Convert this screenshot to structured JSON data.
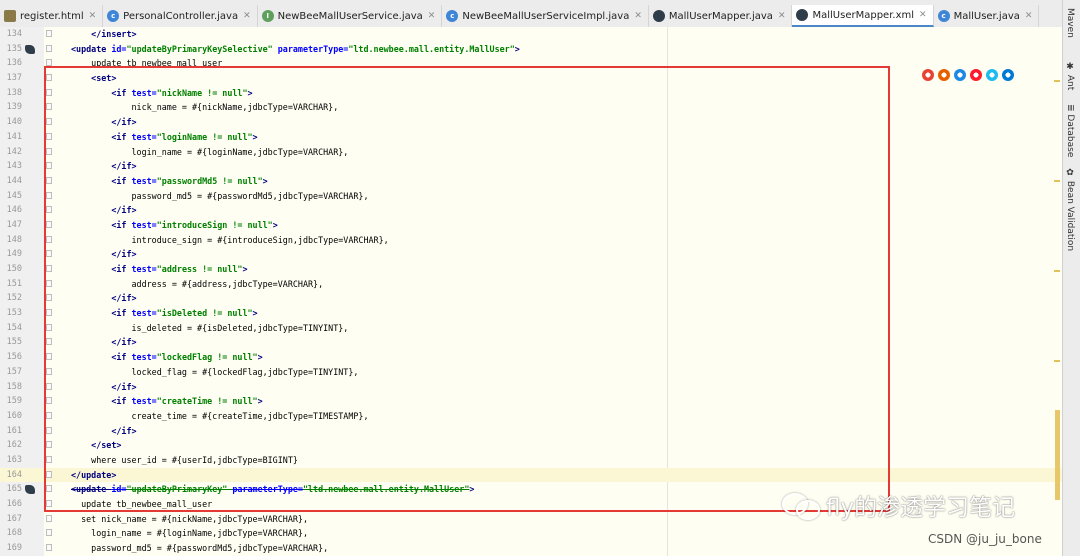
{
  "tabs": [
    {
      "label": "register.html",
      "icon": "html-file-icon",
      "color": "#8a7a4a",
      "glyph": "",
      "active": false
    },
    {
      "label": "PersonalController.java",
      "icon": "class-icon",
      "color": "#3f86d6",
      "glyph": "c",
      "active": false
    },
    {
      "label": "NewBeeMallUserService.java",
      "icon": "interface-icon",
      "color": "#5fa05f",
      "glyph": "I",
      "active": false
    },
    {
      "label": "NewBeeMallUserServiceImpl.java",
      "icon": "class-icon",
      "color": "#3f86d6",
      "glyph": "c",
      "active": false
    },
    {
      "label": "MallUserMapper.java",
      "icon": "mybatis-icon",
      "color": "#2f3d4a",
      "glyph": "",
      "active": false
    },
    {
      "label": "MallUserMapper.xml",
      "icon": "mybatis-icon",
      "color": "#2f3d4a",
      "glyph": "",
      "active": true
    },
    {
      "label": "MallUser.java",
      "icon": "class-icon",
      "color": "#3f86d6",
      "glyph": "c",
      "active": false
    }
  ],
  "lines": [
    {
      "num": "134",
      "parts": [
        {
          "t": "    ",
          "c": "body"
        },
        {
          "t": "</insert>",
          "c": "tag"
        }
      ]
    },
    {
      "num": "135",
      "icon": true,
      "hl": true,
      "parts": [
        {
          "t": "<update ",
          "c": "tag"
        },
        {
          "t": "id=",
          "c": "attr"
        },
        {
          "t": "\"updateByPrimaryKeySelective\" ",
          "c": "val"
        },
        {
          "t": "parameterType=",
          "c": "attr"
        },
        {
          "t": "\"ltd.newbee.mall.entity.MallUser\"",
          "c": "val"
        },
        {
          "t": ">",
          "c": "tag"
        }
      ]
    },
    {
      "num": "136",
      "parts": [
        {
          "t": "    update tb_newbee_mall_user",
          "c": "body"
        }
      ]
    },
    {
      "num": "137",
      "parts": [
        {
          "t": "    ",
          "c": "body"
        },
        {
          "t": "<set>",
          "c": "tag"
        }
      ]
    },
    {
      "num": "138",
      "parts": [
        {
          "t": "        ",
          "c": "body"
        },
        {
          "t": "<if ",
          "c": "tag"
        },
        {
          "t": "test=",
          "c": "attr"
        },
        {
          "t": "\"nickName != null\"",
          "c": "val"
        },
        {
          "t": ">",
          "c": "tag"
        }
      ]
    },
    {
      "num": "139",
      "parts": [
        {
          "t": "            nick_name = #{nickName,jdbcType=VARCHAR},",
          "c": "body"
        }
      ]
    },
    {
      "num": "140",
      "parts": [
        {
          "t": "        ",
          "c": "body"
        },
        {
          "t": "</if>",
          "c": "tag"
        }
      ]
    },
    {
      "num": "141",
      "parts": [
        {
          "t": "        ",
          "c": "body"
        },
        {
          "t": "<if ",
          "c": "tag"
        },
        {
          "t": "test=",
          "c": "attr"
        },
        {
          "t": "\"loginName != null\"",
          "c": "val"
        },
        {
          "t": ">",
          "c": "tag"
        }
      ]
    },
    {
      "num": "142",
      "parts": [
        {
          "t": "            login_name = #{loginName,jdbcType=VARCHAR},",
          "c": "body"
        }
      ]
    },
    {
      "num": "143",
      "parts": [
        {
          "t": "        ",
          "c": "body"
        },
        {
          "t": "</if>",
          "c": "tag"
        }
      ]
    },
    {
      "num": "144",
      "parts": [
        {
          "t": "        ",
          "c": "body"
        },
        {
          "t": "<if ",
          "c": "tag"
        },
        {
          "t": "test=",
          "c": "attr"
        },
        {
          "t": "\"passwordMd5 != null\"",
          "c": "val"
        },
        {
          "t": ">",
          "c": "tag"
        }
      ]
    },
    {
      "num": "145",
      "parts": [
        {
          "t": "            password_md5 = #{passwordMd5,jdbcType=VARCHAR},",
          "c": "body"
        }
      ]
    },
    {
      "num": "146",
      "parts": [
        {
          "t": "        ",
          "c": "body"
        },
        {
          "t": "</if>",
          "c": "tag"
        }
      ]
    },
    {
      "num": "147",
      "parts": [
        {
          "t": "        ",
          "c": "body"
        },
        {
          "t": "<if ",
          "c": "tag"
        },
        {
          "t": "test=",
          "c": "attr"
        },
        {
          "t": "\"introduceSign != null\"",
          "c": "val"
        },
        {
          "t": ">",
          "c": "tag"
        }
      ]
    },
    {
      "num": "148",
      "parts": [
        {
          "t": "            introduce_sign = #{introduceSign,jdbcType=VARCHAR},",
          "c": "body"
        }
      ]
    },
    {
      "num": "149",
      "parts": [
        {
          "t": "        ",
          "c": "body"
        },
        {
          "t": "</if>",
          "c": "tag"
        }
      ]
    },
    {
      "num": "150",
      "parts": [
        {
          "t": "        ",
          "c": "body"
        },
        {
          "t": "<if ",
          "c": "tag"
        },
        {
          "t": "test=",
          "c": "attr"
        },
        {
          "t": "\"address != null\"",
          "c": "val"
        },
        {
          "t": ">",
          "c": "tag"
        }
      ]
    },
    {
      "num": "151",
      "parts": [
        {
          "t": "            address = #{address,jdbcType=VARCHAR},",
          "c": "body"
        }
      ]
    },
    {
      "num": "152",
      "parts": [
        {
          "t": "        ",
          "c": "body"
        },
        {
          "t": "</if>",
          "c": "tag"
        }
      ]
    },
    {
      "num": "153",
      "parts": [
        {
          "t": "        ",
          "c": "body"
        },
        {
          "t": "<if ",
          "c": "tag"
        },
        {
          "t": "test=",
          "c": "attr"
        },
        {
          "t": "\"isDeleted != null\"",
          "c": "val"
        },
        {
          "t": ">",
          "c": "tag"
        }
      ]
    },
    {
      "num": "154",
      "parts": [
        {
          "t": "            is_deleted = #{isDeleted,jdbcType=TINYINT},",
          "c": "body"
        }
      ]
    },
    {
      "num": "155",
      "parts": [
        {
          "t": "        ",
          "c": "body"
        },
        {
          "t": "</if>",
          "c": "tag"
        }
      ]
    },
    {
      "num": "156",
      "parts": [
        {
          "t": "        ",
          "c": "body"
        },
        {
          "t": "<if ",
          "c": "tag"
        },
        {
          "t": "test=",
          "c": "attr"
        },
        {
          "t": "\"lockedFlag != null\"",
          "c": "val"
        },
        {
          "t": ">",
          "c": "tag"
        }
      ]
    },
    {
      "num": "157",
      "parts": [
        {
          "t": "            locked_flag = #{lockedFlag,jdbcType=TINYINT},",
          "c": "body"
        }
      ]
    },
    {
      "num": "158",
      "parts": [
        {
          "t": "        ",
          "c": "body"
        },
        {
          "t": "</if>",
          "c": "tag"
        }
      ]
    },
    {
      "num": "159",
      "parts": [
        {
          "t": "        ",
          "c": "body"
        },
        {
          "t": "<if ",
          "c": "tag"
        },
        {
          "t": "test=",
          "c": "attr"
        },
        {
          "t": "\"createTime != null\"",
          "c": "val"
        },
        {
          "t": ">",
          "c": "tag"
        }
      ]
    },
    {
      "num": "160",
      "parts": [
        {
          "t": "            create_time = #{createTime,jdbcType=TIMESTAMP},",
          "c": "body"
        }
      ]
    },
    {
      "num": "161",
      "parts": [
        {
          "t": "        ",
          "c": "body"
        },
        {
          "t": "</if>",
          "c": "tag"
        }
      ]
    },
    {
      "num": "162",
      "parts": [
        {
          "t": "    ",
          "c": "body"
        },
        {
          "t": "</set>",
          "c": "tag"
        }
      ]
    },
    {
      "num": "163",
      "parts": [
        {
          "t": "    where user_id = #{userId,jdbcType=BIGINT}",
          "c": "body"
        }
      ]
    },
    {
      "num": "164",
      "current": true,
      "hl": true,
      "parts": [
        {
          "t": "</update>",
          "c": "tag"
        }
      ]
    },
    {
      "num": "165",
      "icon": true,
      "parts": [
        {
          "t": "<update ",
          "c": "tag strike"
        },
        {
          "t": "id=",
          "c": "attr strike"
        },
        {
          "t": "\"updateByPrimaryKey\" ",
          "c": "val strike"
        },
        {
          "t": "parameterType=",
          "c": "attr strike"
        },
        {
          "t": "\"ltd.newbee.mall.entity.MallUser\"",
          "c": "val strike"
        },
        {
          "t": ">",
          "c": "tag"
        }
      ]
    },
    {
      "num": "166",
      "parts": [
        {
          "t": "  update tb_newbee_mall_user",
          "c": "body"
        }
      ]
    },
    {
      "num": "167",
      "parts": [
        {
          "t": "  set nick_name = #{nickName,jdbcType=VARCHAR},",
          "c": "body"
        }
      ]
    },
    {
      "num": "168",
      "parts": [
        {
          "t": "    login_name = #{loginName,jdbcType=VARCHAR},",
          "c": "body"
        }
      ]
    },
    {
      "num": "169",
      "parts": [
        {
          "t": "    password_md5 = #{passwordMd5,jdbcType=VARCHAR},",
          "c": "body"
        }
      ]
    }
  ],
  "browsers": [
    {
      "name": "chrome-icon",
      "color": "#e94235"
    },
    {
      "name": "firefox-icon",
      "color": "#e66000"
    },
    {
      "name": "safari-icon",
      "color": "#1e88e5"
    },
    {
      "name": "opera-icon",
      "color": "#ff1b2d"
    },
    {
      "name": "ie-icon",
      "color": "#1ebbee"
    },
    {
      "name": "edge-icon",
      "color": "#0078d7"
    }
  ],
  "right_tools": [
    "Maven",
    "Ant",
    "Database",
    "Bean Validation"
  ],
  "watermark": "fly的渗透学习笔记",
  "credit": "CSDN @ju_ju_bone",
  "colors": {
    "highlight_box": "#e53935",
    "editor_bg": "#fffef2",
    "tag": "#000080",
    "attr": "#0000ff",
    "value": "#008000"
  }
}
